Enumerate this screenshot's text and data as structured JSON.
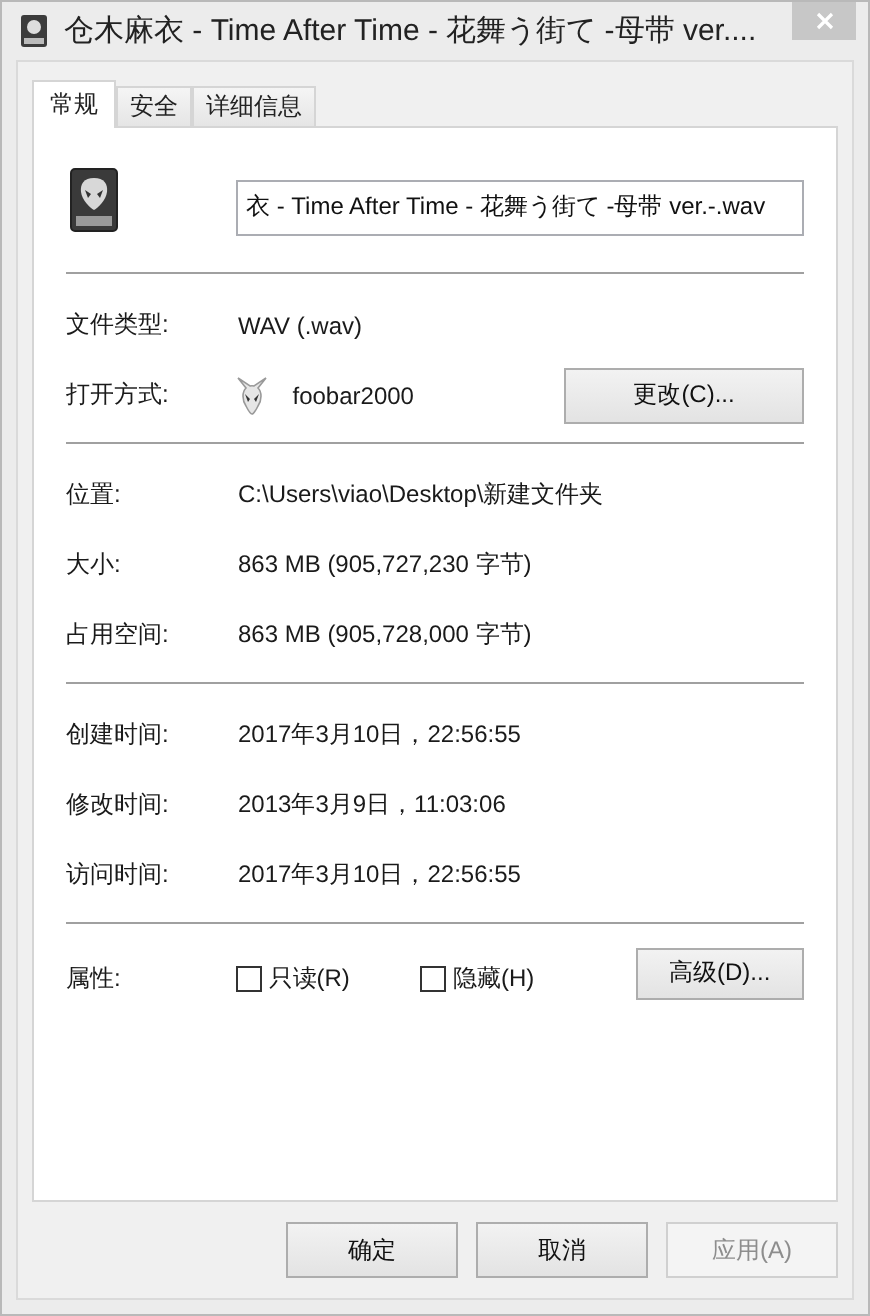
{
  "window": {
    "title": "仓木麻衣 - Time After Time - 花舞う街て -母带 ver...."
  },
  "tabs": [
    {
      "label": "常规",
      "selected": true
    },
    {
      "label": "安全",
      "selected": false
    },
    {
      "label": "详细信息",
      "selected": false
    }
  ],
  "file_name": "衣 - Time After Time - 花舞う街て -母带 ver.-.wav",
  "sections": [
    [
      {
        "kind": "text",
        "label": "文件类型:",
        "value": "WAV (.wav)"
      },
      {
        "kind": "app",
        "label": "打开方式:",
        "value": "foobar2000",
        "button": "更改(C)..."
      }
    ],
    [
      {
        "kind": "text",
        "label": "位置:",
        "value": "C:\\Users\\viao\\Desktop\\新建文件夹"
      },
      {
        "kind": "text",
        "label": "大小:",
        "value": "863 MB (905,727,230 字节)"
      },
      {
        "kind": "text",
        "label": "占用空间:",
        "value": "863 MB (905,728,000 字节)"
      }
    ],
    [
      {
        "kind": "text",
        "label": "创建时间:",
        "value": "2017年3月10日，22:56:55"
      },
      {
        "kind": "text",
        "label": "修改时间:",
        "value": "2013年3月9日，11:03:06"
      },
      {
        "kind": "text",
        "label": "访问时间:",
        "value": "2017年3月10日，22:56:55"
      }
    ]
  ],
  "attributes": {
    "label": "属性:",
    "checkboxes": [
      {
        "label": "只读(R)",
        "checked": false
      },
      {
        "label": "隐藏(H)",
        "checked": false
      }
    ],
    "button": "高级(D)..."
  },
  "buttons": [
    {
      "label": "确定",
      "disabled": false
    },
    {
      "label": "取消",
      "disabled": false
    },
    {
      "label": "应用(A)",
      "disabled": true
    }
  ]
}
